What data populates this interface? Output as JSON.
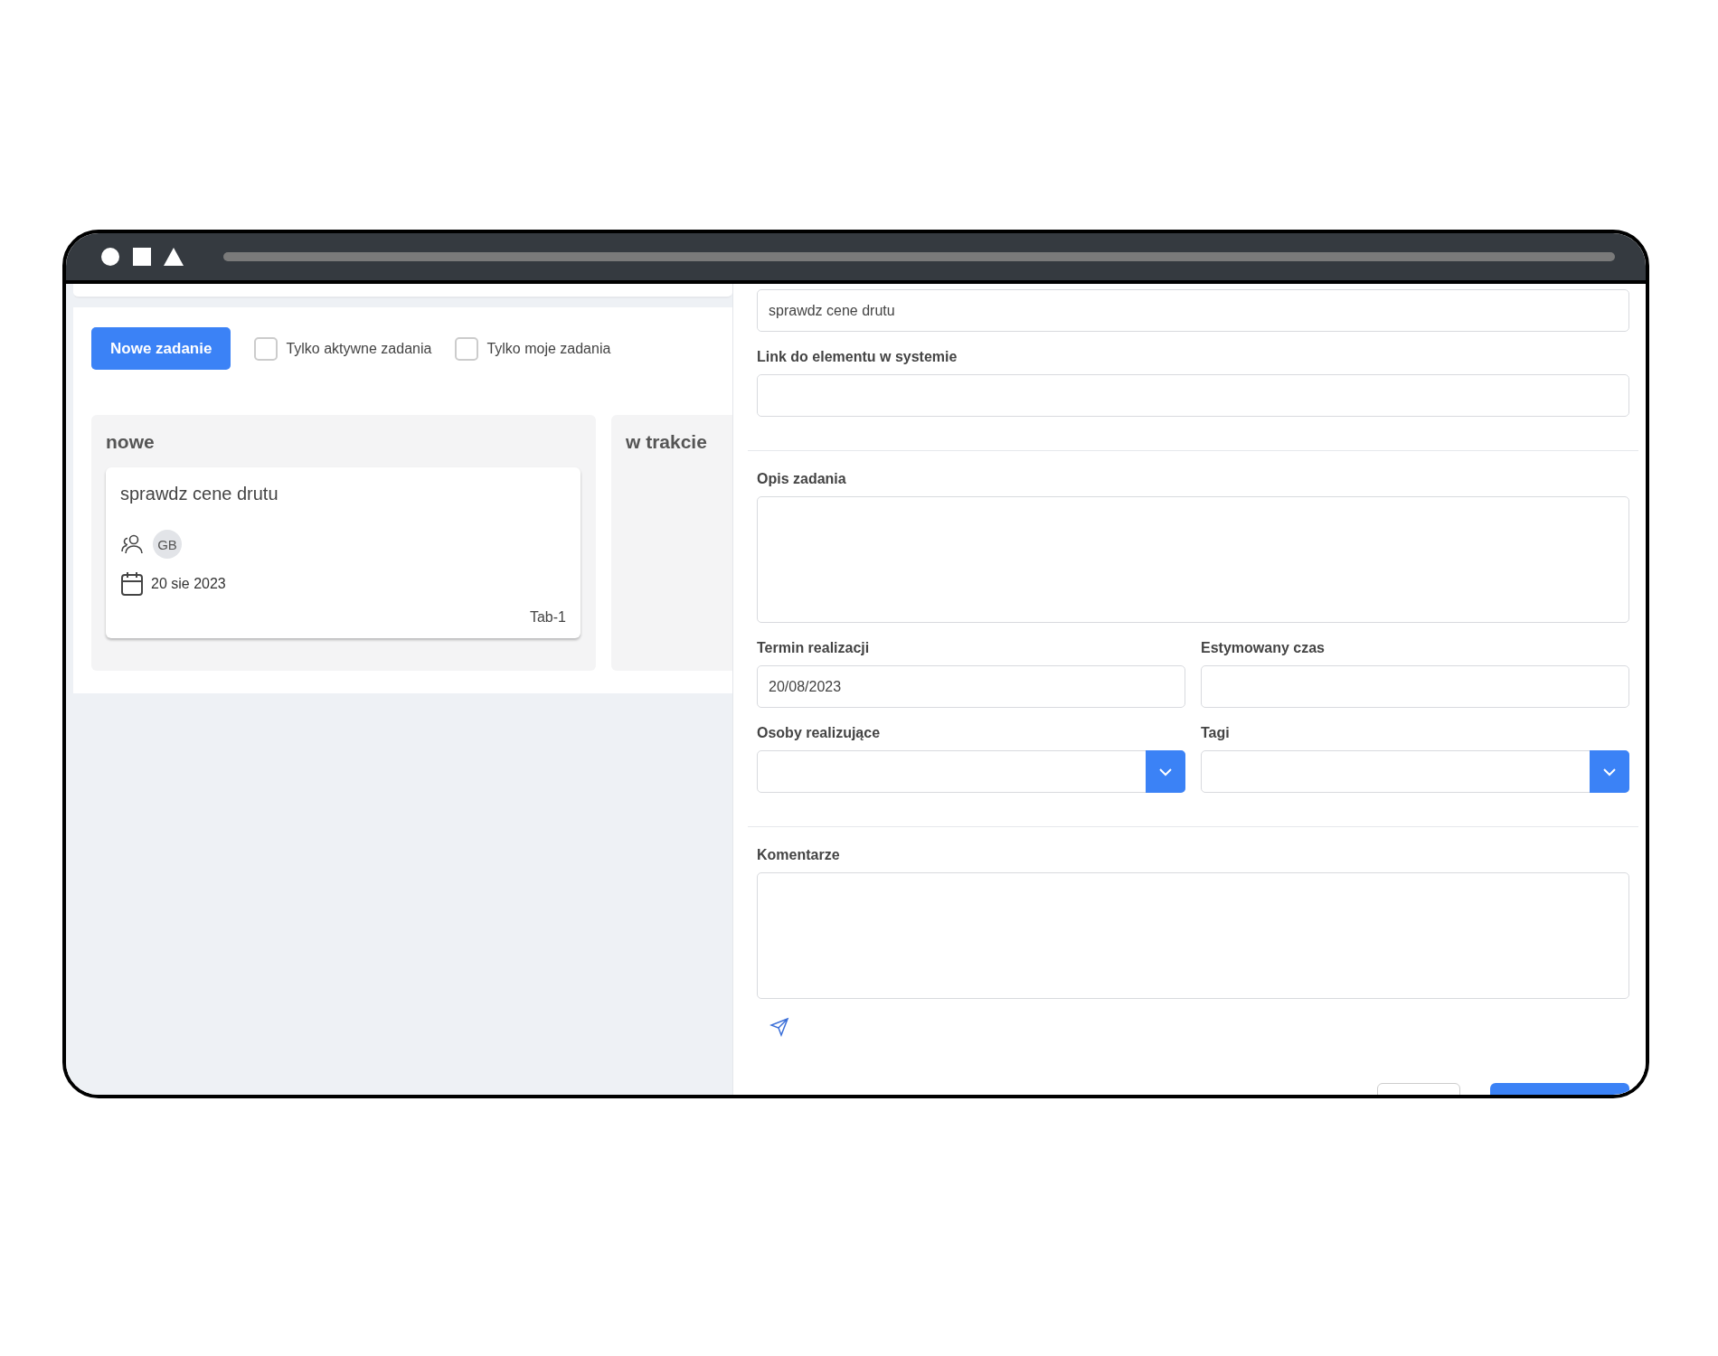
{
  "toolbar": {
    "new_button": "Nowe zadanie",
    "filters": [
      {
        "label": "Tylko aktywne zadania",
        "checked": false
      },
      {
        "label": "Tylko moje zadania",
        "checked": false
      }
    ]
  },
  "board": {
    "columns": [
      {
        "title": "nowe",
        "cards": [
          {
            "title": "sprawdz cene drutu",
            "assignees": [
              "GB"
            ],
            "date": "20 sie 2023",
            "tag": "Tab-1"
          }
        ]
      },
      {
        "title": "w trakcie"
      }
    ]
  },
  "form": {
    "sections": [
      {
        "rows": [
          [
            {
              "kind": "text",
              "value": "sprawdz cene drutu"
            }
          ],
          [
            {
              "kind": "text",
              "label": "Link do elementu w systemie"
            }
          ]
        ]
      },
      {
        "rows": [
          [
            {
              "kind": "textarea",
              "label": "Opis zadania"
            }
          ],
          [
            {
              "kind": "text",
              "label": "Termin realizacji",
              "value": "20/08/2023"
            },
            {
              "kind": "text",
              "label": "Estymowany czas"
            }
          ],
          [
            {
              "kind": "select",
              "label": "Osoby realizujące"
            },
            {
              "kind": "select",
              "label": "Tagi"
            }
          ]
        ]
      },
      {
        "rows": [
          [
            {
              "kind": "textarea",
              "label": "Komentarze"
            }
          ]
        ]
      }
    ]
  }
}
